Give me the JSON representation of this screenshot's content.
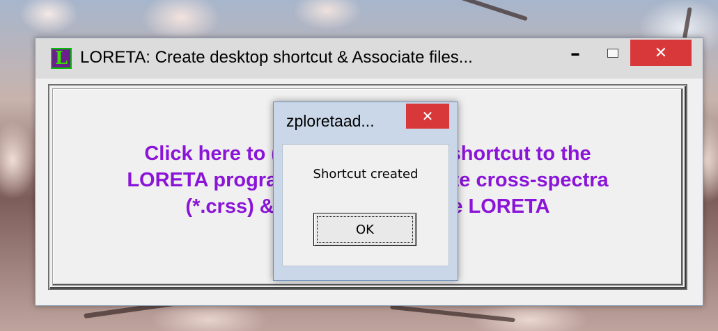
{
  "main_window": {
    "title": "LORETA: Create desktop shortcut & Associate files...",
    "app_icon_letter": "L",
    "minimize_label": "–",
    "close_label": "✕",
    "button_text": "Click here to (1) create desktop shortcut to the\nLORETA program, and (2) associate cross-spectra\n(*.crss) & loreta files with the LORETA",
    "button_text_color": "#8a14d8"
  },
  "dialog": {
    "title": "zploretaad...",
    "close_label": "✕",
    "message": "Shortcut created",
    "ok_label": "OK"
  },
  "colors": {
    "close_button": "#d9383a",
    "dialog_frame": "#c9d7e8"
  }
}
